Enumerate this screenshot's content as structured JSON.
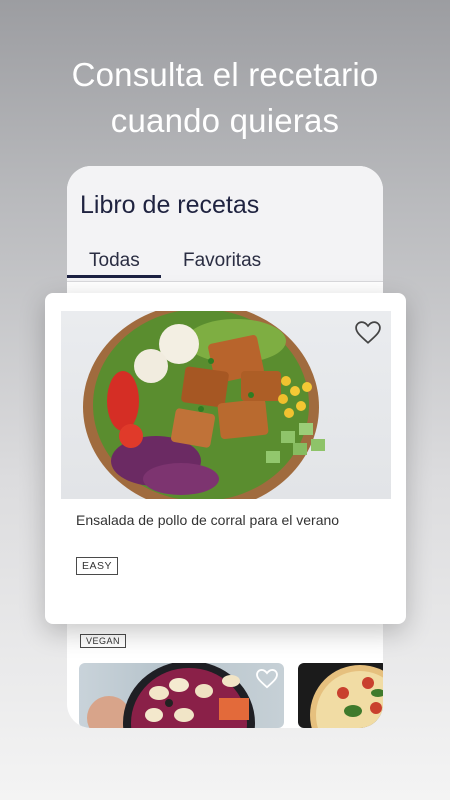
{
  "headline": {
    "line1": "Consulta el recetario",
    "line2": "cuando quieras"
  },
  "app": {
    "title": "Libro de recetas",
    "tabs": [
      {
        "label": "Todas",
        "active": true
      },
      {
        "label": "Favoritas",
        "active": false
      }
    ]
  },
  "featured": {
    "title": "Ensalada de pollo de corral para el verano",
    "badge": "EASY",
    "favorite_icon": "heart-outline-icon"
  },
  "list": {
    "badge": "VEGAN"
  },
  "colors": {
    "accent": "#1c2142",
    "text": "#1f2340"
  }
}
